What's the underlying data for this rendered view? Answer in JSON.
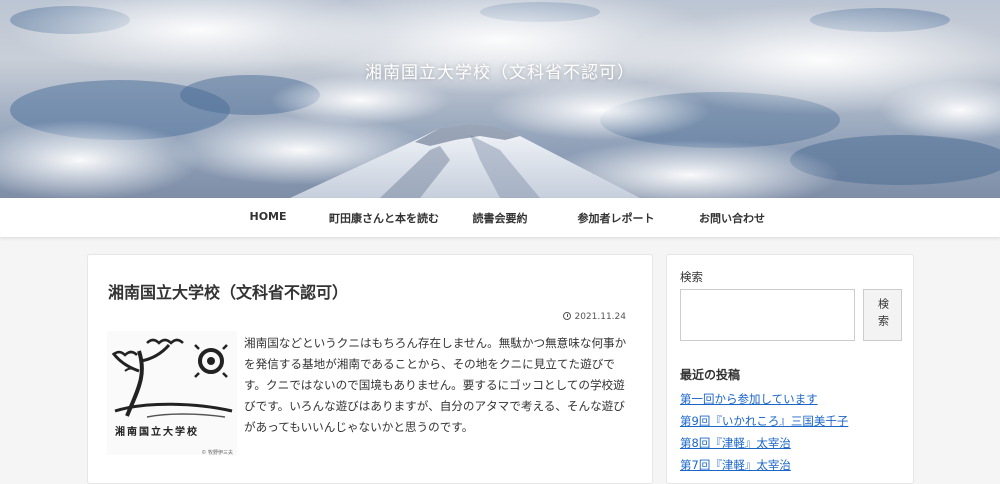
{
  "header": {
    "site_title": "湘南国立大学校（文科省不認可）"
  },
  "nav": {
    "items": [
      {
        "label": "HOME"
      },
      {
        "label": "町田康さんと本を読む"
      },
      {
        "label": "読書会要約"
      },
      {
        "label": "参加者レポート"
      },
      {
        "label": "お問い合わせ"
      }
    ]
  },
  "post": {
    "title": "湘南国立大学校（文科省不認可）",
    "date": "2021.11.24",
    "thumbnail_caption": "湘南国立大学校",
    "thumbnail_credit": "© 牧野伊三夫",
    "excerpt": "湘南国などというクニはもちろん存在しません。無駄かつ無意味な何事かを発信する基地が湘南であることから、その地をクニに見立てた遊びです。クニではないので国境もありません。要するにゴッコとしての学校遊びです。いろんな遊びはありますが、自分のアタマで考える、そんな遊びがあってもいいんじゃないかと思うのです。"
  },
  "sidebar": {
    "search_label": "検索",
    "search_placeholder": "",
    "search_button": "検索",
    "recent_title": "最近の投稿",
    "recent_posts": [
      {
        "label": "第一回から参加しています"
      },
      {
        "label": "第9回『いかれころ』三国美千子"
      },
      {
        "label": "第8回『津軽』太宰治"
      },
      {
        "label": "第7回『津軽』太宰治"
      }
    ]
  },
  "colors": {
    "link": "#1b66c9",
    "background": "#f5f5f5"
  }
}
